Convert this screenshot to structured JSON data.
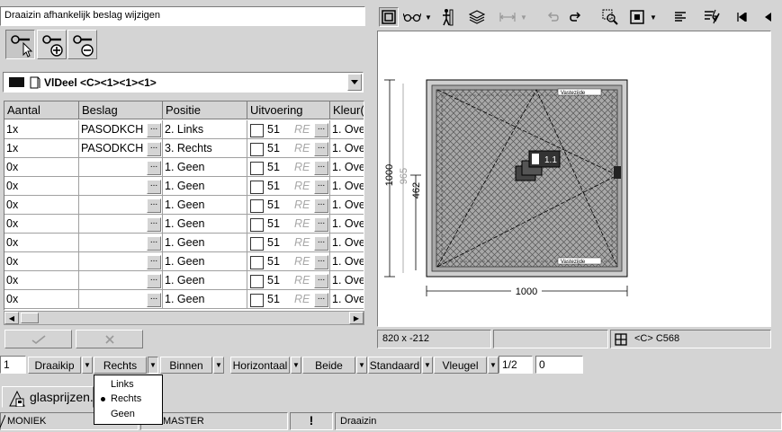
{
  "title": "Draaizin afhankelijk beslag wijzigen",
  "selector": {
    "label": "VlDeel <C><1><1><1>"
  },
  "table": {
    "columns": [
      "Aantal",
      "Beslag",
      "Positie",
      "Uitvoering",
      "Kleur(e"
    ],
    "rows": [
      {
        "aantal": "1x",
        "beslag": "PASODKCH",
        "positie": "2. Links",
        "uitvoering": "51",
        "re": "RE",
        "kleur": "1. Ove"
      },
      {
        "aantal": "1x",
        "beslag": "PASODKCH",
        "positie": "3. Rechts",
        "uitvoering": "51",
        "re": "RE",
        "kleur": "1. Ove"
      },
      {
        "aantal": "0x",
        "beslag": "",
        "positie": "1. Geen",
        "uitvoering": "51",
        "re": "RE",
        "kleur": "1. Ove"
      },
      {
        "aantal": "0x",
        "beslag": "",
        "positie": "1. Geen",
        "uitvoering": "51",
        "re": "RE",
        "kleur": "1. Ove"
      },
      {
        "aantal": "0x",
        "beslag": "",
        "positie": "1. Geen",
        "uitvoering": "51",
        "re": "RE",
        "kleur": "1. Ove"
      },
      {
        "aantal": "0x",
        "beslag": "",
        "positie": "1. Geen",
        "uitvoering": "51",
        "re": "RE",
        "kleur": "1. Ove"
      },
      {
        "aantal": "0x",
        "beslag": "",
        "positie": "1. Geen",
        "uitvoering": "51",
        "re": "RE",
        "kleur": "1. Ove"
      },
      {
        "aantal": "0x",
        "beslag": "",
        "positie": "1. Geen",
        "uitvoering": "51",
        "re": "RE",
        "kleur": "1. Ove"
      },
      {
        "aantal": "0x",
        "beslag": "",
        "positie": "1. Geen",
        "uitvoering": "51",
        "re": "RE",
        "kleur": "1. Ove"
      },
      {
        "aantal": "0x",
        "beslag": "",
        "positie": "1. Geen",
        "uitvoering": "51",
        "re": "RE",
        "kleur": "1. Ove"
      }
    ],
    "dots": "..."
  },
  "actions": {
    "ok_icon": "checkmark-icon",
    "cancel_icon": "cross-icon"
  },
  "drawing": {
    "dim_width": "1000",
    "dim_height": "1000",
    "dim_inner": "965",
    "dim_handle": "462",
    "tag": "1.1",
    "corner_top": "Vastezijde",
    "corner_bottom": "Vastezijde"
  },
  "status": {
    "coords": "820 x -212",
    "middle": "",
    "code": "<C> C568"
  },
  "bottom": {
    "count": "1",
    "type": "Draaikip",
    "side": "Rechts",
    "direction": "Binnen",
    "orientation": "Horizontaal",
    "both": "Beide",
    "standard": "Standaard",
    "sash": "Vleugel",
    "fraction": "1/2",
    "value": "0"
  },
  "popup": {
    "items": [
      "Links",
      "Rechts",
      "Geen"
    ],
    "selected": "Rechts"
  },
  "file_tab": "glasprijzen.jpg",
  "statusbar": {
    "user": "MONIEK",
    "server": "MASTER",
    "mode": "Draaizin"
  },
  "colors": {
    "bg": "#d4d4d4",
    "field": "#ffffff",
    "dim_text": "#9a9a9a"
  }
}
